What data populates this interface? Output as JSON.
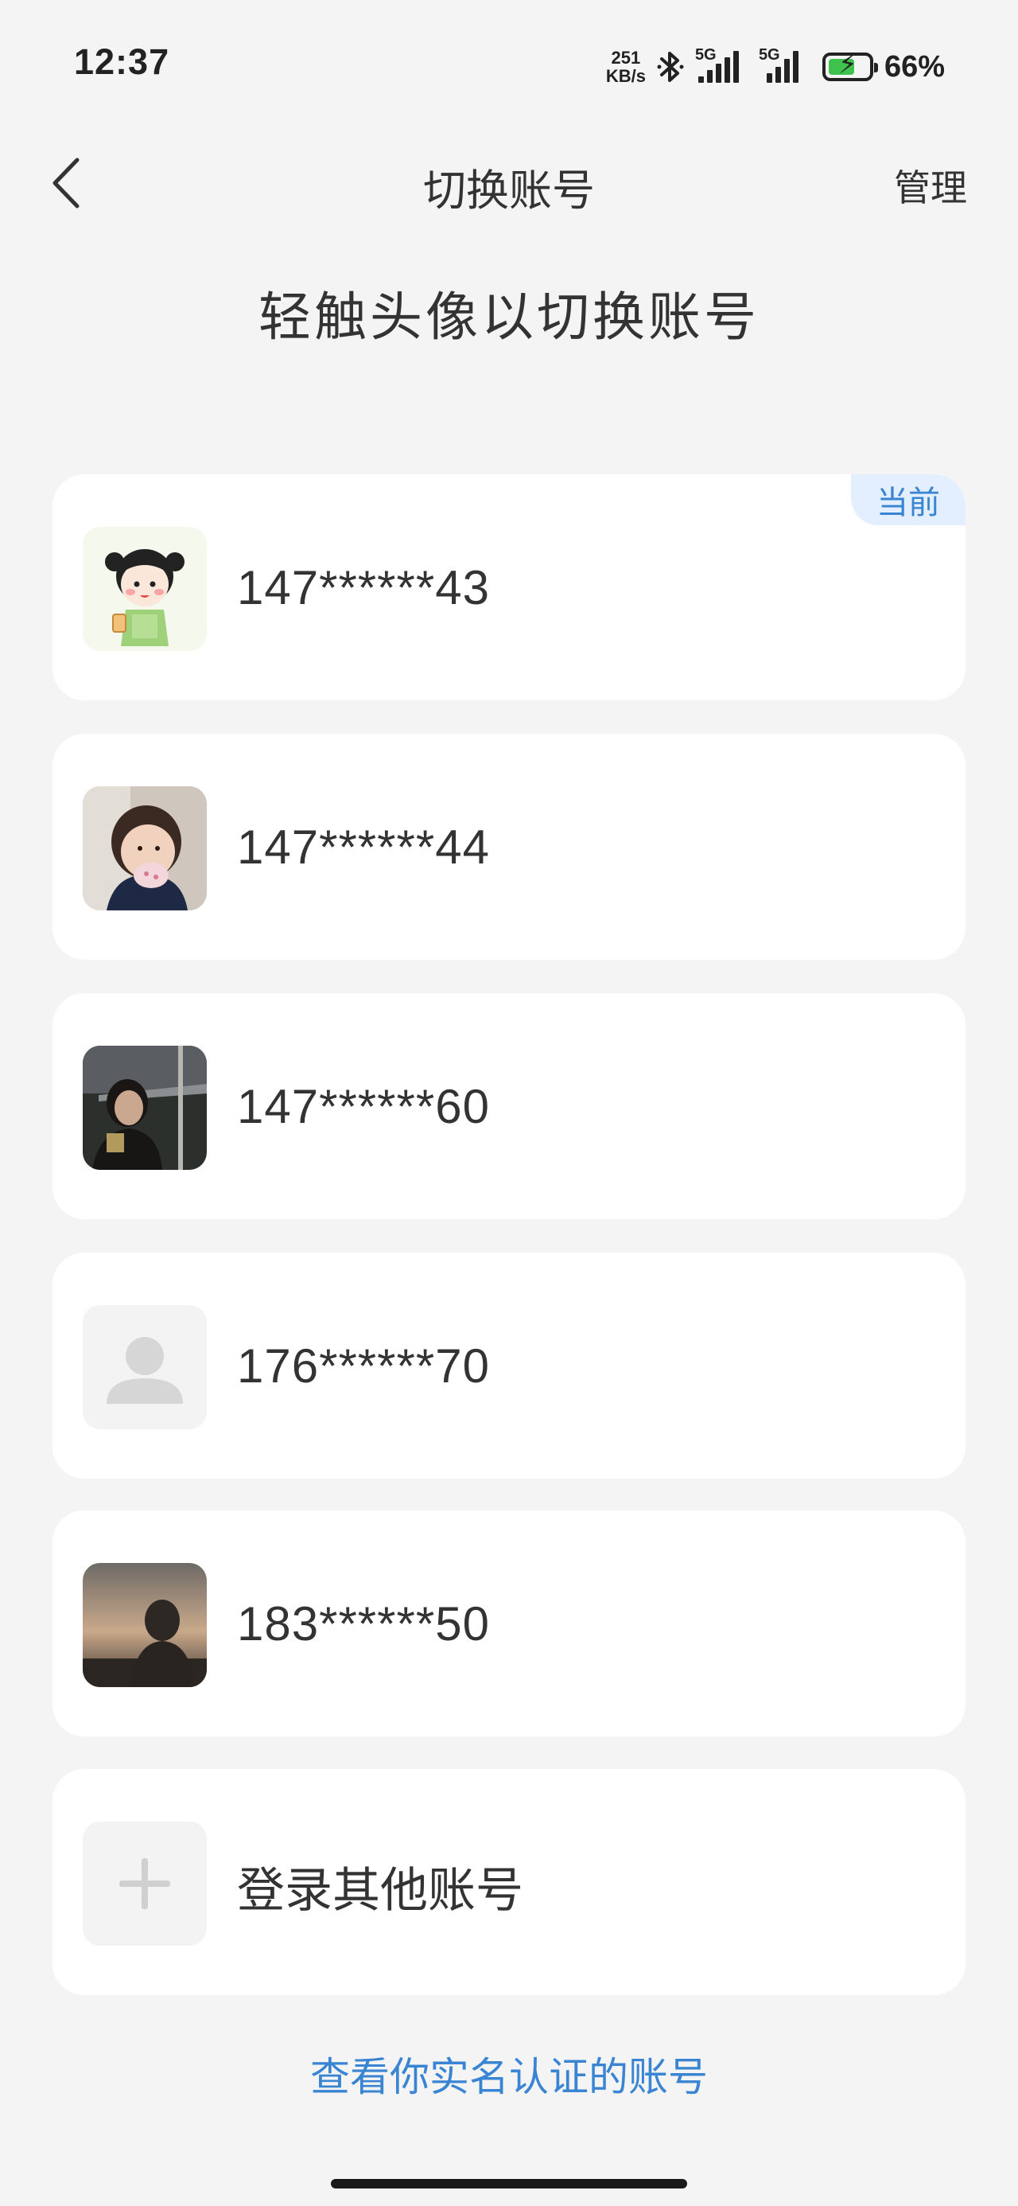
{
  "status_bar": {
    "time": "12:37",
    "net_speed_value": "251",
    "net_speed_unit": "KB/s",
    "sim1_label": "5G",
    "sim2_label": "5G",
    "battery_percent": "66%",
    "battery_level": 0.66
  },
  "header": {
    "title": "切换账号",
    "manage_label": "管理"
  },
  "subtitle": "轻触头像以切换账号",
  "accounts": [
    {
      "number": "147******43",
      "current": true,
      "avatar": "cartoon-girl-avatar"
    },
    {
      "number": "147******44",
      "current": false,
      "avatar": "child-photo-avatar"
    },
    {
      "number": "147******60",
      "current": false,
      "avatar": "night-portrait-avatar"
    },
    {
      "number": "176******70",
      "current": false,
      "avatar": "default-person-icon"
    },
    {
      "number": "183******50",
      "current": false,
      "avatar": "sunset-silhouette-avatar"
    }
  ],
  "current_badge_label": "当前",
  "add_account_label": "登录其他账号",
  "realname_link": "查看你实名认证的账号",
  "colors": {
    "background": "#f4f4f4",
    "card": "#ffffff",
    "accent_blue": "#3a84d4",
    "badge_bg": "#e3efff",
    "battery_green": "#3cc24d"
  }
}
